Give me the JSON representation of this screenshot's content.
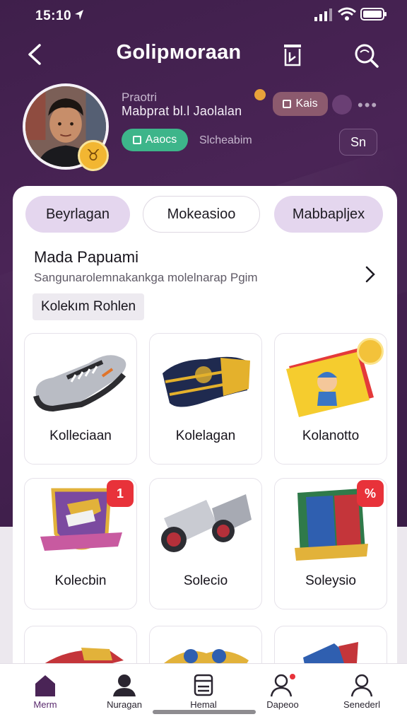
{
  "status_bar": {
    "time": "15:10"
  },
  "top_nav": {
    "title": "Golipмoraan"
  },
  "profile": {
    "overline": "Praotri",
    "name": "Mabprat bl.l Jaolalan",
    "level_chip": "Kais",
    "green_chip": "Aaocs",
    "meta": "Slcheabim",
    "edit_button": "Sn"
  },
  "tabs": [
    {
      "label": "Beyrlagan"
    },
    {
      "label": "Mokeasioo"
    },
    {
      "label": "Mabbapljex"
    }
  ],
  "section": {
    "title": "Mada Papuami",
    "subtitle": "Sangunarolemnakankga molelnarap Pgim",
    "chip": "Kolekım Rohlen"
  },
  "items": [
    {
      "label": "Kolleciaan",
      "icon": "sneaker-icon"
    },
    {
      "label": "Kolelagan",
      "icon": "scarf-icon"
    },
    {
      "label": "Kolanotto",
      "icon": "sticker-book-icon"
    },
    {
      "label": "Kolecbin",
      "icon": "crest-badge-icon",
      "badge": "1"
    },
    {
      "label": "Solecio",
      "icon": "binoculars-icon"
    },
    {
      "label": "Soleysio",
      "icon": "banner-icon",
      "badge": "%"
    }
  ],
  "bottom_nav": [
    {
      "label": "Merm",
      "icon": "home-icon"
    },
    {
      "label": "Nuragan",
      "icon": "user-icon"
    },
    {
      "label": "Hemal",
      "icon": "box-icon"
    },
    {
      "label": "Dapeoo",
      "icon": "people-icon"
    },
    {
      "label": "Senederl",
      "icon": "profile-icon"
    }
  ],
  "colors": {
    "hero": "#4a2456",
    "tab_active": "#e4d6ee",
    "green_chip": "#3db58a",
    "badge_red": "#e8323a",
    "accent_purple": "#5a2a6e"
  }
}
